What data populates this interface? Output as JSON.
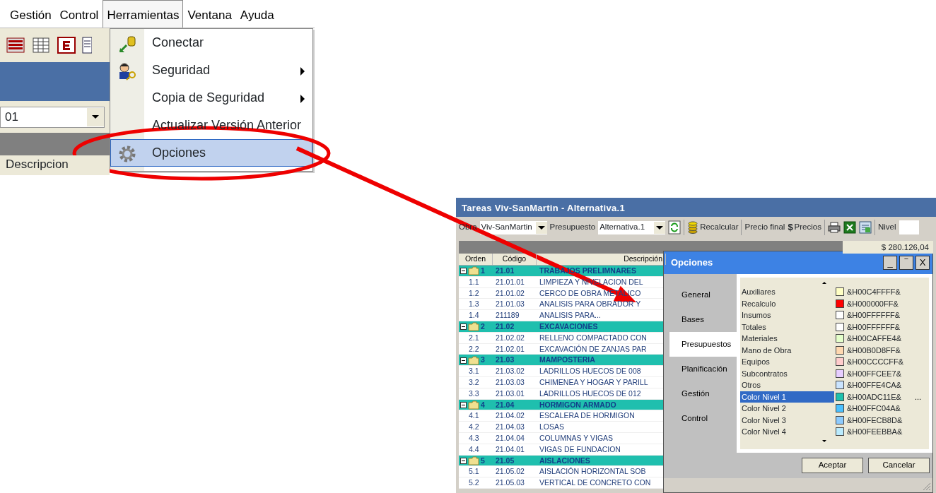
{
  "menu_screenshot": {
    "menubar": [
      {
        "label": "Gestión",
        "selected": false
      },
      {
        "label": "Control",
        "selected": false
      },
      {
        "label": "Herramientas",
        "selected": true
      },
      {
        "label": "Ventana",
        "selected": false
      },
      {
        "label": "Ayuda",
        "selected": false
      }
    ],
    "behind": {
      "combo_value": "01",
      "column_header": "Descripcion"
    },
    "dropdown": [
      {
        "label": "Conectar",
        "submenu": false,
        "selected": false
      },
      {
        "label": "Seguridad",
        "submenu": true,
        "selected": false
      },
      {
        "label": "Copia de Seguridad",
        "submenu": true,
        "selected": false
      },
      {
        "label": "Actualizar Versión Anterior",
        "submenu": false,
        "selected": false
      },
      {
        "label": "Opciones",
        "submenu": false,
        "selected": true
      }
    ]
  },
  "app_window": {
    "title": "Tareas Viv-SanMartin - Alternativa.1",
    "toolbar": {
      "obra_label": "Obra",
      "obra_value": "Viv-SanMartin",
      "presupuesto_label": "Presupuesto",
      "presupuesto_value": "Alternativa.1",
      "recalcular": "Recalcular",
      "precio_final": "Precio final",
      "precios_symbol": "$",
      "precios": "Precios",
      "nivel_label": "Nivel"
    },
    "total": "$ 280.126,04",
    "table": {
      "columns": [
        "Orden",
        "Código",
        "Descripción"
      ],
      "rows": [
        {
          "kind": "group",
          "expanded": true,
          "orden": "1",
          "codigo": "21.01",
          "descripcion": "TRABAJOS PRELIMNARES"
        },
        {
          "kind": "item",
          "orden": "1.1",
          "codigo": "21.01.01",
          "descripcion": "LIMPIEZA Y NIVELACION DEL"
        },
        {
          "kind": "item",
          "orden": "1.2",
          "codigo": "21.01.02",
          "descripcion": "CERCO DE OBRA METALICO"
        },
        {
          "kind": "item",
          "orden": "1.3",
          "codigo": "21.01.03",
          "descripcion": "ANALISIS PARA OBRADOR Y"
        },
        {
          "kind": "item",
          "orden": "1.4",
          "codigo": "211189",
          "descripcion": "ANALISIS PARA..."
        },
        {
          "kind": "group",
          "expanded": true,
          "orden": "2",
          "codigo": "21.02",
          "descripcion": "EXCAVACIONES"
        },
        {
          "kind": "item",
          "orden": "2.1",
          "codigo": "21.02.02",
          "descripcion": "RELLENO COMPACTADO CON"
        },
        {
          "kind": "item",
          "orden": "2.2",
          "codigo": "21.02.01",
          "descripcion": "EXCAVACIÓN DE ZANJAS PAR"
        },
        {
          "kind": "group",
          "expanded": true,
          "orden": "3",
          "codigo": "21.03",
          "descripcion": "MAMPOSTERIA"
        },
        {
          "kind": "item",
          "orden": "3.1",
          "codigo": "21.03.02",
          "descripcion": "LADRILLOS HUECOS DE 008"
        },
        {
          "kind": "item",
          "orden": "3.2",
          "codigo": "21.03.03",
          "descripcion": "CHIMENEA Y HOGAR Y PARILL"
        },
        {
          "kind": "item",
          "orden": "3.3",
          "codigo": "21.03.01",
          "descripcion": "LADRILLOS HUECOS DE 012"
        },
        {
          "kind": "group",
          "expanded": true,
          "orden": "4",
          "codigo": "21.04",
          "descripcion": "HORMIGON ARMADO"
        },
        {
          "kind": "item",
          "orden": "4.1",
          "codigo": "21.04.02",
          "descripcion": "ESCALERA DE HORMIGON"
        },
        {
          "kind": "item",
          "orden": "4.2",
          "codigo": "21.04.03",
          "descripcion": "LOSAS"
        },
        {
          "kind": "item",
          "orden": "4.3",
          "codigo": "21.04.04",
          "descripcion": "COLUMNAS Y VIGAS"
        },
        {
          "kind": "item",
          "orden": "4.4",
          "codigo": "21.04.01",
          "descripcion": "VIGAS DE FUNDACION"
        },
        {
          "kind": "group",
          "expanded": true,
          "orden": "5",
          "codigo": "21.05",
          "descripcion": "AISLACIONES"
        },
        {
          "kind": "item",
          "orden": "5.1",
          "codigo": "21.05.02",
          "descripcion": "AISLACIÓN HORIZONTAL SOB"
        },
        {
          "kind": "item",
          "orden": "5.2",
          "codigo": "21.05.03",
          "descripcion": "VERTICAL DE CONCRETO CON"
        }
      ]
    }
  },
  "options_dialog": {
    "title": "Opciones",
    "window_buttons": [
      "_",
      "‾",
      "X"
    ],
    "tabs": [
      {
        "label": "General",
        "selected": false
      },
      {
        "label": "Bases",
        "selected": false
      },
      {
        "label": "Presupuestos",
        "selected": true
      },
      {
        "label": "Planificación",
        "selected": false
      },
      {
        "label": "Gestión",
        "selected": false
      },
      {
        "label": "Control",
        "selected": false
      }
    ],
    "colors": [
      {
        "name": "Auxiliares",
        "color": "#ffffc4",
        "value": "&H00C4FFFF&",
        "selected": false
      },
      {
        "name": "Recalculo",
        "color": "#ff0000",
        "value": "&H000000FF&",
        "selected": false
      },
      {
        "name": "Insumos",
        "color": "#ffffff",
        "value": "&H00FFFFFF&",
        "selected": false
      },
      {
        "name": "Totales",
        "color": "#ffffff",
        "value": "&H00FFFFFF&",
        "selected": false
      },
      {
        "name": "Materiales",
        "color": "#e4ffca",
        "value": "&H00CAFFE4&",
        "selected": false
      },
      {
        "name": "Mano de Obra",
        "color": "#ffd8b0",
        "value": "&H00B0D8FF&",
        "selected": false
      },
      {
        "name": "Equipos",
        "color": "#ffcccc",
        "value": "&H00CCCCFF&",
        "selected": false
      },
      {
        "name": "Subcontratos",
        "color": "#e7ceff",
        "value": "&H00FFCEE7&",
        "selected": false
      },
      {
        "name": "Otros",
        "color": "#cae4ff",
        "value": "&H00FFE4CA&",
        "selected": false
      },
      {
        "name": "Color Nivel 1",
        "color": "#1ec1ad",
        "value": "&H00ADC11E&",
        "selected": true
      },
      {
        "name": "Color Nivel 2",
        "color": "#4ac0ff",
        "value": "&H00FFC04A&",
        "selected": false
      },
      {
        "name": "Color Nivel 3",
        "color": "#8dcbfe",
        "value": "&H00FECB8D&",
        "selected": false
      },
      {
        "name": "Color Nivel 4",
        "color": "#baebfe",
        "value": "&H00FEEBBA&",
        "selected": false
      }
    ],
    "more_button": "...",
    "buttons": [
      "Aceptar",
      "Cancelar"
    ]
  }
}
